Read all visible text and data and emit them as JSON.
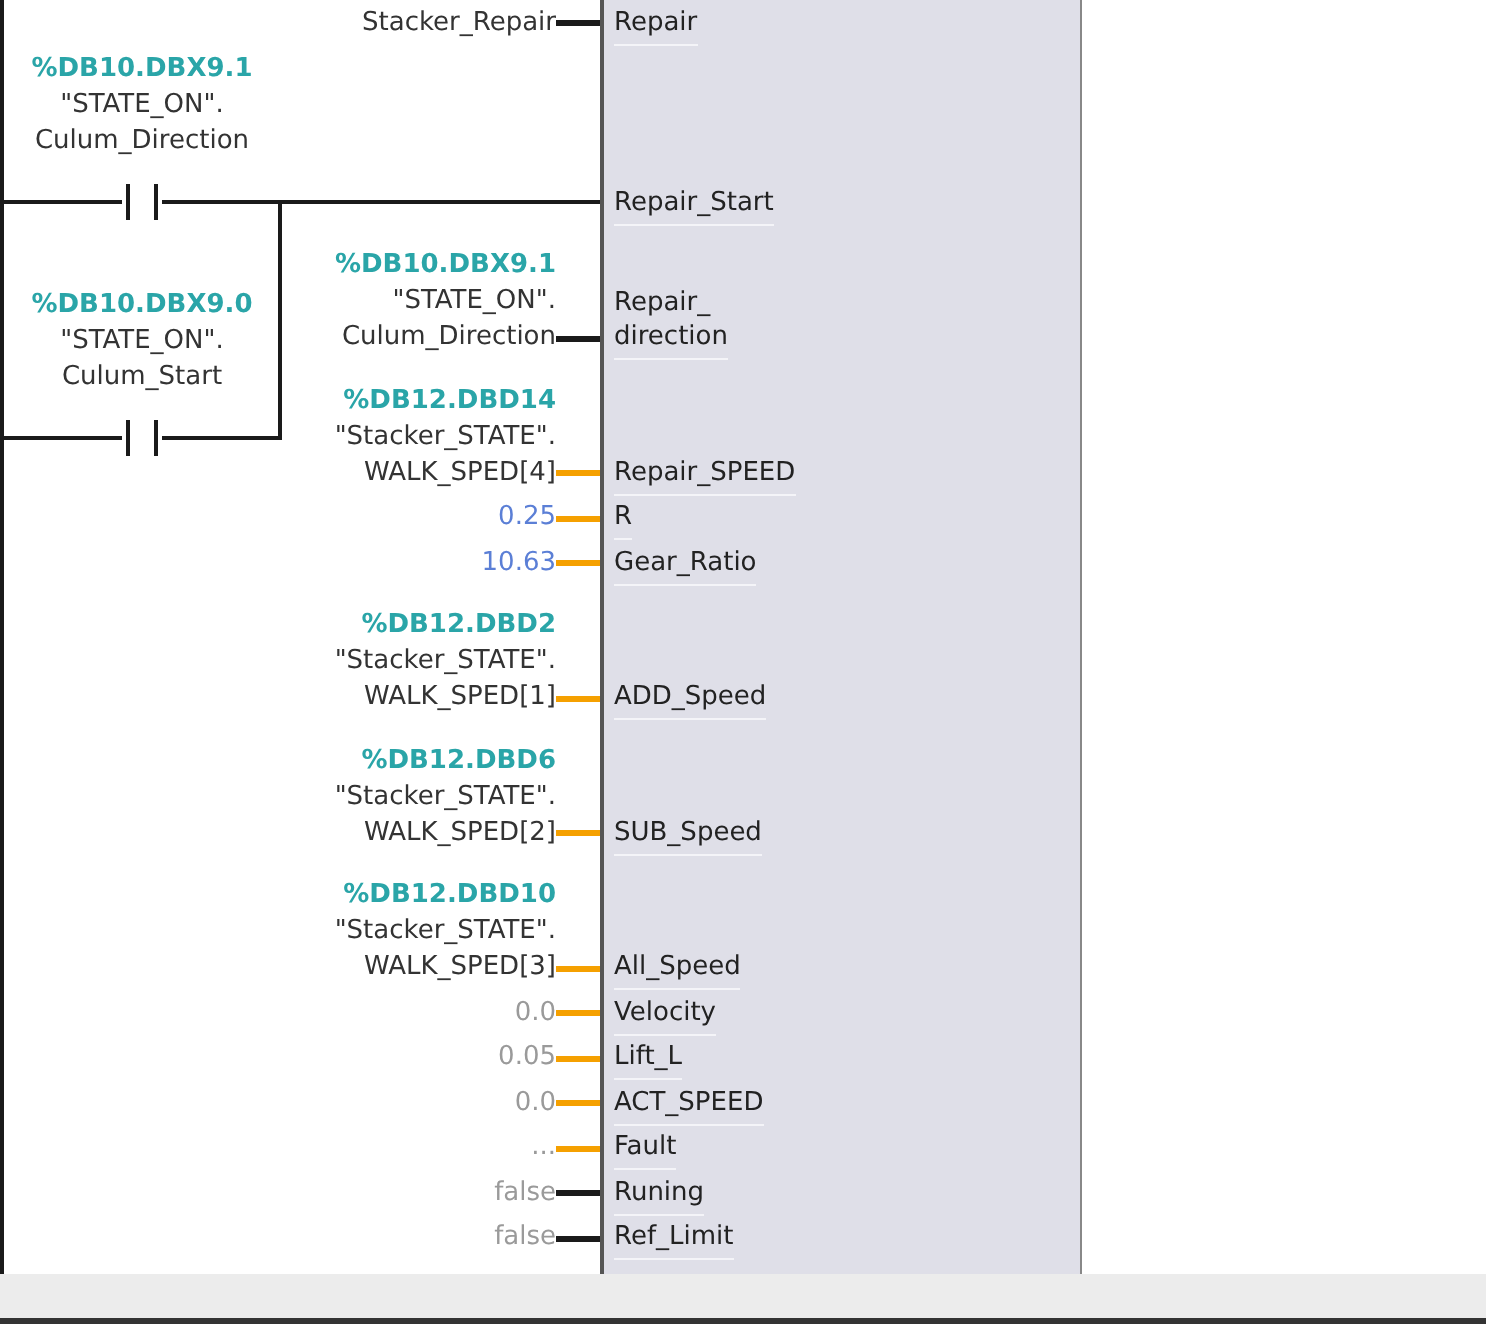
{
  "contacts": [
    {
      "address": "%DB10.DBX9.1",
      "lines": [
        "\"STATE_ON\".",
        "Culum_Direction"
      ]
    },
    {
      "address": "%DB10.DBX9.0",
      "lines": [
        "\"STATE_ON\".",
        "Culum_Start"
      ]
    }
  ],
  "pins": [
    {
      "kind": "tag",
      "lines": [
        "Stacker_Repair"
      ],
      "label": "Repair",
      "boolean": true
    },
    {
      "kind": "rung",
      "label": "Repair_Start"
    },
    {
      "kind": "tag",
      "address": "%DB10.DBX9.1",
      "lines": [
        "\"STATE_ON\".",
        "Culum_Direction"
      ],
      "label": "Repair_\ndirection",
      "boolean": true
    },
    {
      "kind": "tag",
      "address": "%DB12.DBD14",
      "lines": [
        "\"Stacker_STATE\".",
        "WALK_SPED[4]"
      ],
      "label": "Repair_SPEED",
      "boolean": false
    },
    {
      "kind": "constant",
      "value": "0.25",
      "label": "R",
      "boolean": false
    },
    {
      "kind": "constant",
      "value": "10.63",
      "label": "Gear_Ratio",
      "boolean": false
    },
    {
      "kind": "tag",
      "address": "%DB12.DBD2",
      "lines": [
        "\"Stacker_STATE\".",
        "WALK_SPED[1]"
      ],
      "label": "ADD_Speed",
      "boolean": false
    },
    {
      "kind": "tag",
      "address": "%DB12.DBD6",
      "lines": [
        "\"Stacker_STATE\".",
        "WALK_SPED[2]"
      ],
      "label": "SUB_Speed",
      "boolean": false
    },
    {
      "kind": "tag",
      "address": "%DB12.DBD10",
      "lines": [
        "\"Stacker_STATE\".",
        "WALK_SPED[3]"
      ],
      "label": "All_Speed",
      "boolean": false
    },
    {
      "kind": "default",
      "value": "0.0",
      "label": "Velocity",
      "boolean": false
    },
    {
      "kind": "default",
      "value": "0.05",
      "label": "Lift_L",
      "boolean": false
    },
    {
      "kind": "default",
      "value": "0.0",
      "label": "ACT_SPEED",
      "boolean": false
    },
    {
      "kind": "default",
      "value": "...",
      "label": "Fault",
      "boolean": false
    },
    {
      "kind": "default",
      "value": "false",
      "label": "Runing",
      "boolean": true
    },
    {
      "kind": "default",
      "value": "false",
      "label": "Ref_Limit",
      "boolean": true
    }
  ]
}
